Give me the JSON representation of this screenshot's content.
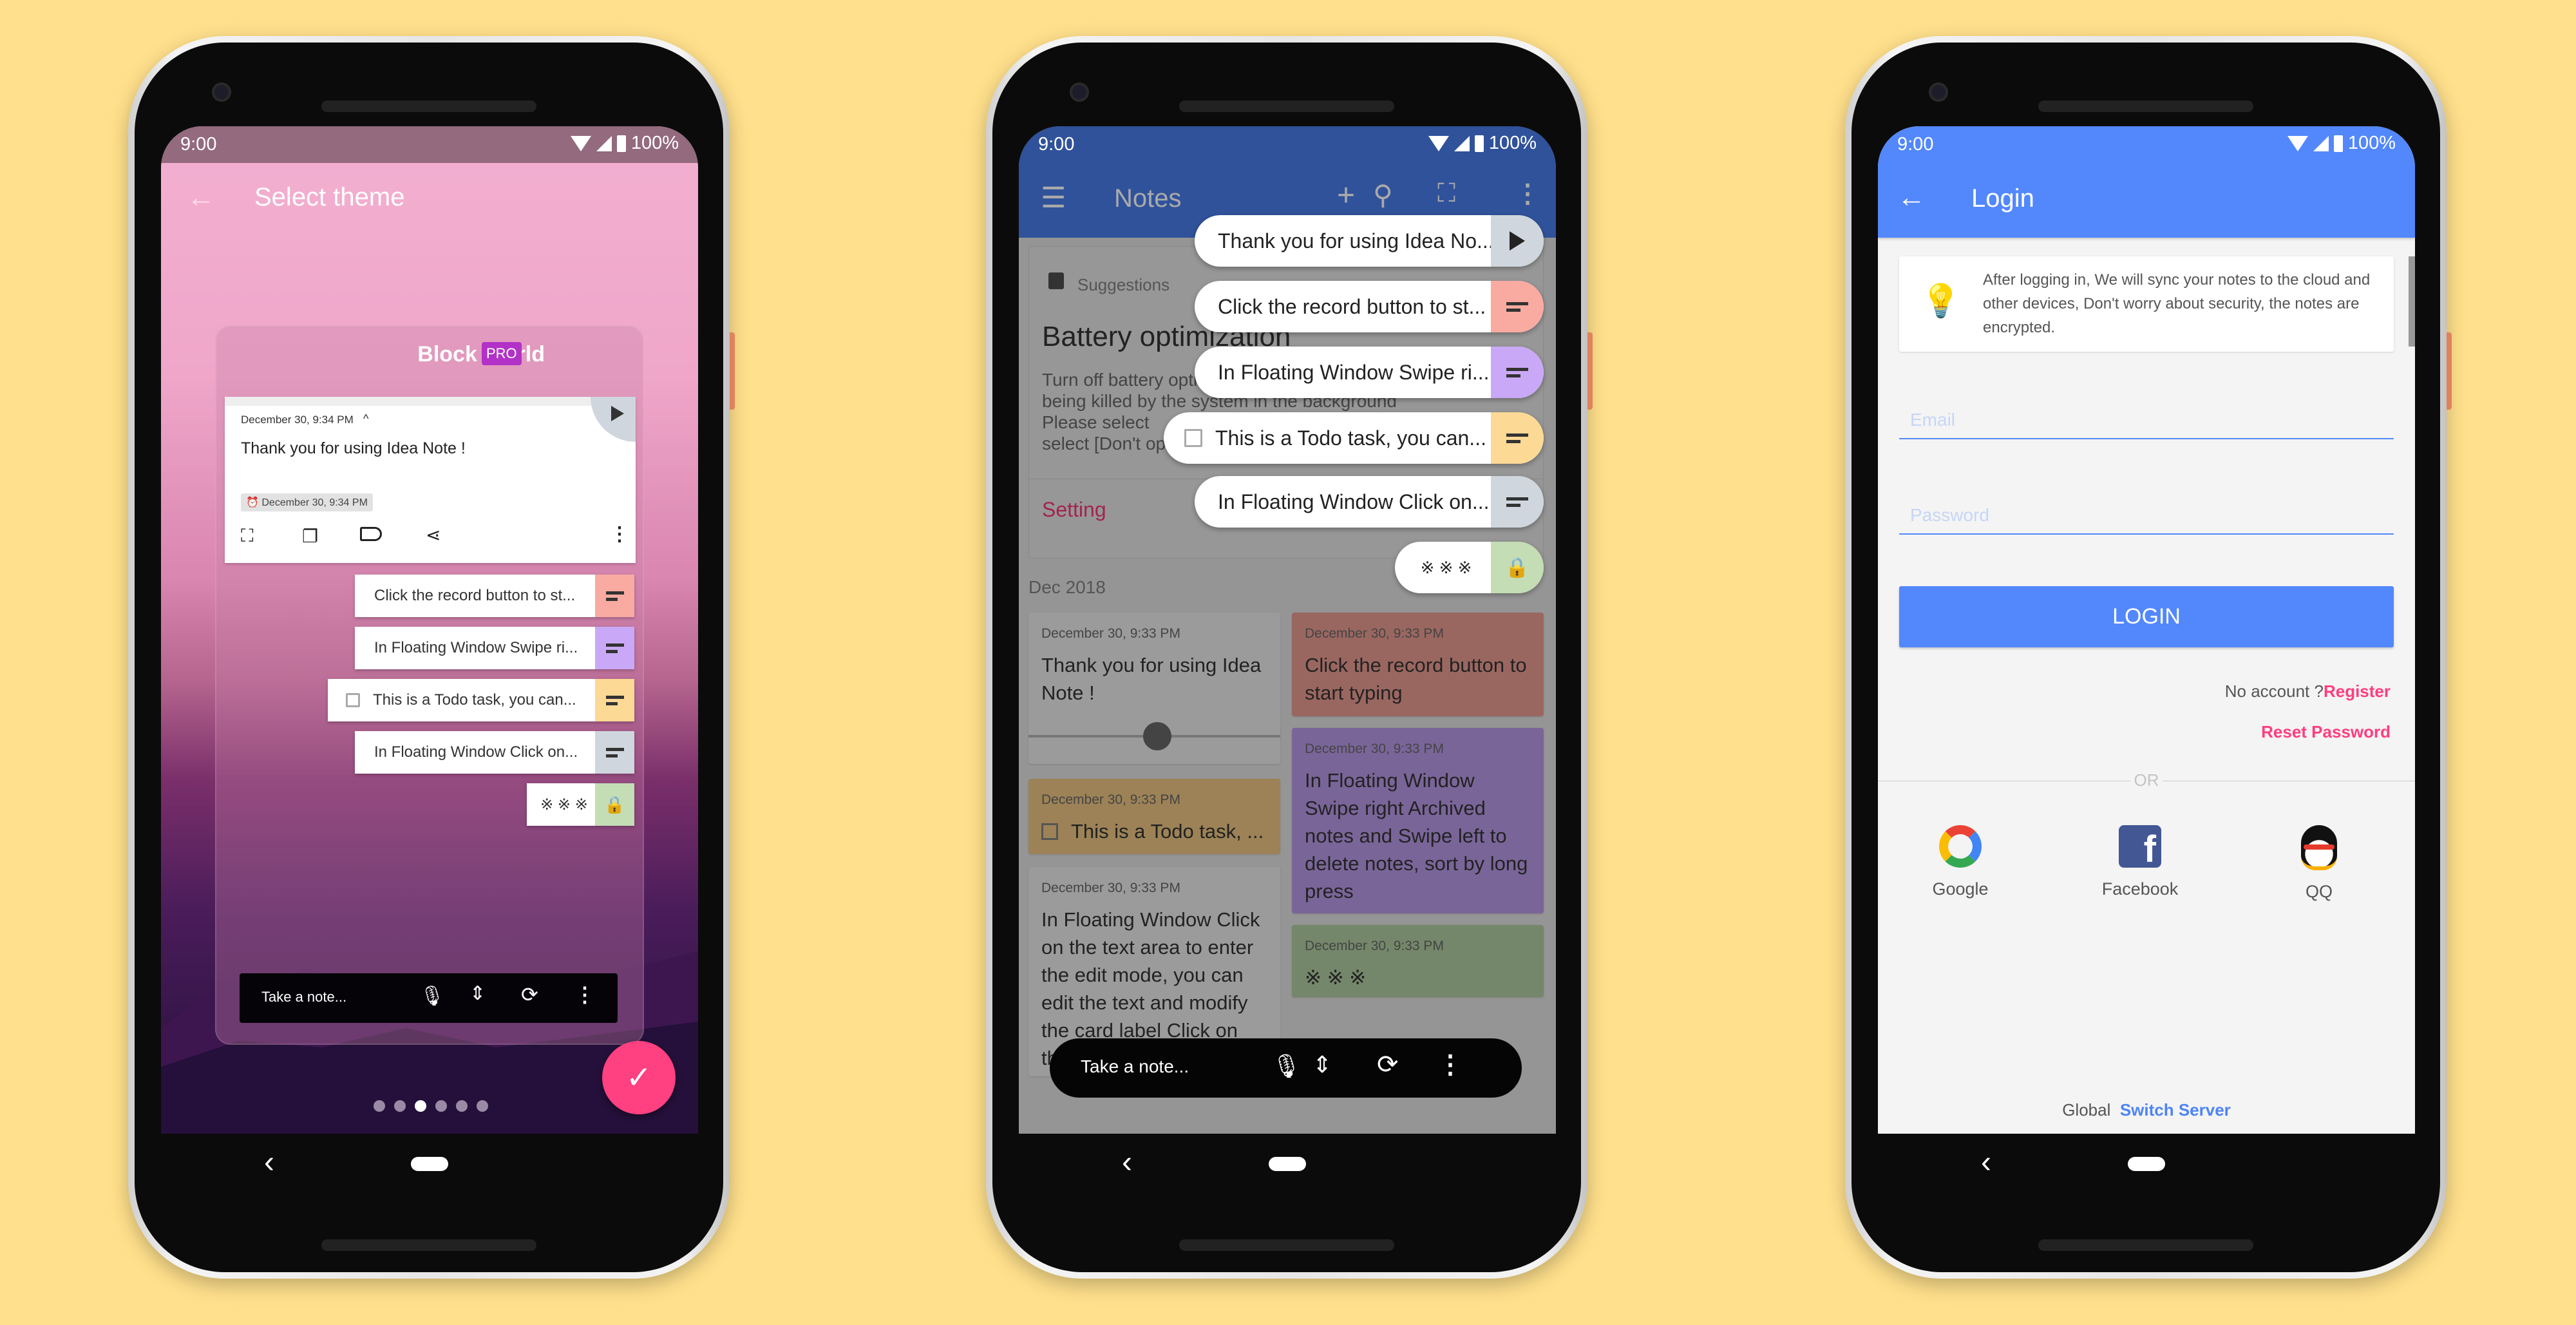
{
  "status": {
    "time": "9:00",
    "battery": "100%"
  },
  "theme_screen": {
    "title": "Select theme",
    "theme_name": "Block World",
    "badge": "PRO",
    "note": {
      "date": "December 30, 9:34 PM",
      "text": "Thank you for using Idea Note !",
      "reminder": "December 30, 9:34 PM"
    },
    "pills": [
      {
        "text": "Click the record button to st...",
        "color": "#F9ABA1"
      },
      {
        "text": "In Floating Window Swipe ri...",
        "color": "#C9A9F7"
      },
      {
        "text": "This is a Todo task, you can...",
        "color": "#FDD996"
      },
      {
        "text": "In Floating Window Click on...",
        "color": "#D0D6DE"
      },
      {
        "text": "※ ※ ※",
        "color": "#C4DDB5"
      }
    ],
    "bottom_bar": {
      "placeholder": "Take a note..."
    },
    "page_dots": {
      "count": 6,
      "active": 3
    },
    "fab_color": "#FF4081"
  },
  "notes_screen": {
    "title": "Notes",
    "appbar_color": "#30529A",
    "suggestion": {
      "label": "Suggestions",
      "title": "Battery optimization",
      "lines": [
        "Turn off battery optimization to prevent",
        "being killed by the system in the background",
        "Please select",
        "select [Don't optimize]"
      ],
      "action": "Setting"
    },
    "section": "Dec 2018",
    "notes": [
      {
        "date": "December 30, 9:33 PM",
        "text": "Thank you for using Idea Note !",
        "color": "#9B9B9B"
      },
      {
        "date": "December 30, 9:33 PM",
        "text": "This is a Todo task, ...",
        "color": "#9C8256"
      },
      {
        "date": "December 30, 9:33 PM",
        "text": "In Floating Window Click on the text area to enter the edit mode, you can edit the text and modify the card label Click on the blank area",
        "color": "#9B9B9B"
      },
      {
        "date": "December 30, 9:33 PM",
        "text": "Click the record button to start typing",
        "color": "#9A6760"
      },
      {
        "date": "December 30, 9:33 PM",
        "text": "In Floating Window Swipe right Archived notes and Swipe left to delete notes, sort by long press",
        "color": "#7A6599"
      },
      {
        "date": "December 30, 9:33 PM",
        "text": "※ ※ ※",
        "color": "#74876A"
      }
    ],
    "floating": [
      {
        "text": "Thank you for using Idea No...",
        "color": "#CFD6DE"
      },
      {
        "text": "Click the record button to st...",
        "color": "#F9ABA1"
      },
      {
        "text": "In Floating Window Swipe ri...",
        "color": "#C9A9F7"
      },
      {
        "text": "This is a Todo task, you can...",
        "color": "#FDD996"
      },
      {
        "text": "In Floating Window Click on...",
        "color": "#D0D6DE"
      },
      {
        "text": "※ ※ ※",
        "color": "#C4DDB5"
      }
    ],
    "bottom_bar": {
      "placeholder": "Take a note..."
    }
  },
  "login_screen": {
    "title": "Login",
    "primary_color": "#5288FC",
    "info": "After logging in, We will sync your notes to the cloud and other devices, Don't worry about security, the notes are encrypted.",
    "email_placeholder": "Email",
    "password_placeholder": "Password",
    "login_label": "LOGIN",
    "no_account": "No account ?",
    "register": "Register",
    "reset_password": "Reset Password",
    "or": "OR",
    "social": [
      "Google",
      "Facebook",
      "QQ"
    ],
    "server_label": "Global",
    "switch_server": "Switch Server"
  }
}
